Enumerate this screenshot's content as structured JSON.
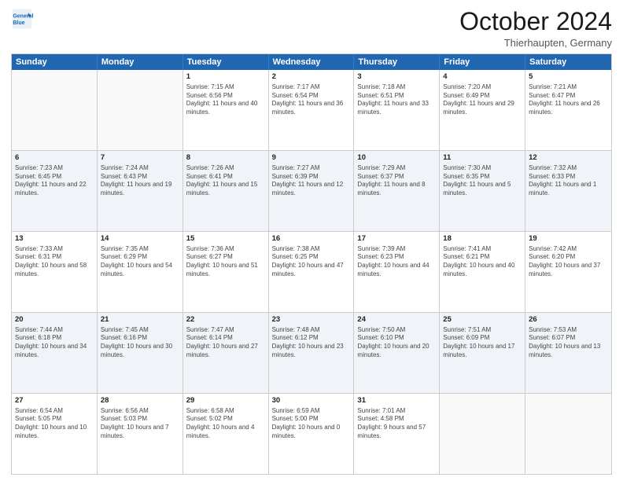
{
  "header": {
    "logo_line1": "General",
    "logo_line2": "Blue",
    "month_title": "October 2024",
    "location": "Thierhaupten, Germany"
  },
  "days_of_week": [
    "Sunday",
    "Monday",
    "Tuesday",
    "Wednesday",
    "Thursday",
    "Friday",
    "Saturday"
  ],
  "rows": [
    [
      {
        "day": "",
        "sunrise": "",
        "sunset": "",
        "daylight": "",
        "empty": true
      },
      {
        "day": "",
        "sunrise": "",
        "sunset": "",
        "daylight": "",
        "empty": true
      },
      {
        "day": "1",
        "sunrise": "Sunrise: 7:15 AM",
        "sunset": "Sunset: 6:56 PM",
        "daylight": "Daylight: 11 hours and 40 minutes."
      },
      {
        "day": "2",
        "sunrise": "Sunrise: 7:17 AM",
        "sunset": "Sunset: 6:54 PM",
        "daylight": "Daylight: 11 hours and 36 minutes."
      },
      {
        "day": "3",
        "sunrise": "Sunrise: 7:18 AM",
        "sunset": "Sunset: 6:51 PM",
        "daylight": "Daylight: 11 hours and 33 minutes."
      },
      {
        "day": "4",
        "sunrise": "Sunrise: 7:20 AM",
        "sunset": "Sunset: 6:49 PM",
        "daylight": "Daylight: 11 hours and 29 minutes."
      },
      {
        "day": "5",
        "sunrise": "Sunrise: 7:21 AM",
        "sunset": "Sunset: 6:47 PM",
        "daylight": "Daylight: 11 hours and 26 minutes."
      }
    ],
    [
      {
        "day": "6",
        "sunrise": "Sunrise: 7:23 AM",
        "sunset": "Sunset: 6:45 PM",
        "daylight": "Daylight: 11 hours and 22 minutes."
      },
      {
        "day": "7",
        "sunrise": "Sunrise: 7:24 AM",
        "sunset": "Sunset: 6:43 PM",
        "daylight": "Daylight: 11 hours and 19 minutes."
      },
      {
        "day": "8",
        "sunrise": "Sunrise: 7:26 AM",
        "sunset": "Sunset: 6:41 PM",
        "daylight": "Daylight: 11 hours and 15 minutes."
      },
      {
        "day": "9",
        "sunrise": "Sunrise: 7:27 AM",
        "sunset": "Sunset: 6:39 PM",
        "daylight": "Daylight: 11 hours and 12 minutes."
      },
      {
        "day": "10",
        "sunrise": "Sunrise: 7:29 AM",
        "sunset": "Sunset: 6:37 PM",
        "daylight": "Daylight: 11 hours and 8 minutes."
      },
      {
        "day": "11",
        "sunrise": "Sunrise: 7:30 AM",
        "sunset": "Sunset: 6:35 PM",
        "daylight": "Daylight: 11 hours and 5 minutes."
      },
      {
        "day": "12",
        "sunrise": "Sunrise: 7:32 AM",
        "sunset": "Sunset: 6:33 PM",
        "daylight": "Daylight: 11 hours and 1 minute."
      }
    ],
    [
      {
        "day": "13",
        "sunrise": "Sunrise: 7:33 AM",
        "sunset": "Sunset: 6:31 PM",
        "daylight": "Daylight: 10 hours and 58 minutes."
      },
      {
        "day": "14",
        "sunrise": "Sunrise: 7:35 AM",
        "sunset": "Sunset: 6:29 PM",
        "daylight": "Daylight: 10 hours and 54 minutes."
      },
      {
        "day": "15",
        "sunrise": "Sunrise: 7:36 AM",
        "sunset": "Sunset: 6:27 PM",
        "daylight": "Daylight: 10 hours and 51 minutes."
      },
      {
        "day": "16",
        "sunrise": "Sunrise: 7:38 AM",
        "sunset": "Sunset: 6:25 PM",
        "daylight": "Daylight: 10 hours and 47 minutes."
      },
      {
        "day": "17",
        "sunrise": "Sunrise: 7:39 AM",
        "sunset": "Sunset: 6:23 PM",
        "daylight": "Daylight: 10 hours and 44 minutes."
      },
      {
        "day": "18",
        "sunrise": "Sunrise: 7:41 AM",
        "sunset": "Sunset: 6:21 PM",
        "daylight": "Daylight: 10 hours and 40 minutes."
      },
      {
        "day": "19",
        "sunrise": "Sunrise: 7:42 AM",
        "sunset": "Sunset: 6:20 PM",
        "daylight": "Daylight: 10 hours and 37 minutes."
      }
    ],
    [
      {
        "day": "20",
        "sunrise": "Sunrise: 7:44 AM",
        "sunset": "Sunset: 6:18 PM",
        "daylight": "Daylight: 10 hours and 34 minutes."
      },
      {
        "day": "21",
        "sunrise": "Sunrise: 7:45 AM",
        "sunset": "Sunset: 6:16 PM",
        "daylight": "Daylight: 10 hours and 30 minutes."
      },
      {
        "day": "22",
        "sunrise": "Sunrise: 7:47 AM",
        "sunset": "Sunset: 6:14 PM",
        "daylight": "Daylight: 10 hours and 27 minutes."
      },
      {
        "day": "23",
        "sunrise": "Sunrise: 7:48 AM",
        "sunset": "Sunset: 6:12 PM",
        "daylight": "Daylight: 10 hours and 23 minutes."
      },
      {
        "day": "24",
        "sunrise": "Sunrise: 7:50 AM",
        "sunset": "Sunset: 6:10 PM",
        "daylight": "Daylight: 10 hours and 20 minutes."
      },
      {
        "day": "25",
        "sunrise": "Sunrise: 7:51 AM",
        "sunset": "Sunset: 6:09 PM",
        "daylight": "Daylight: 10 hours and 17 minutes."
      },
      {
        "day": "26",
        "sunrise": "Sunrise: 7:53 AM",
        "sunset": "Sunset: 6:07 PM",
        "daylight": "Daylight: 10 hours and 13 minutes."
      }
    ],
    [
      {
        "day": "27",
        "sunrise": "Sunrise: 6:54 AM",
        "sunset": "Sunset: 5:05 PM",
        "daylight": "Daylight: 10 hours and 10 minutes."
      },
      {
        "day": "28",
        "sunrise": "Sunrise: 6:56 AM",
        "sunset": "Sunset: 5:03 PM",
        "daylight": "Daylight: 10 hours and 7 minutes."
      },
      {
        "day": "29",
        "sunrise": "Sunrise: 6:58 AM",
        "sunset": "Sunset: 5:02 PM",
        "daylight": "Daylight: 10 hours and 4 minutes."
      },
      {
        "day": "30",
        "sunrise": "Sunrise: 6:59 AM",
        "sunset": "Sunset: 5:00 PM",
        "daylight": "Daylight: 10 hours and 0 minutes."
      },
      {
        "day": "31",
        "sunrise": "Sunrise: 7:01 AM",
        "sunset": "Sunset: 4:58 PM",
        "daylight": "Daylight: 9 hours and 57 minutes."
      },
      {
        "day": "",
        "sunrise": "",
        "sunset": "",
        "daylight": "",
        "empty": true
      },
      {
        "day": "",
        "sunrise": "",
        "sunset": "",
        "daylight": "",
        "empty": true
      }
    ]
  ]
}
